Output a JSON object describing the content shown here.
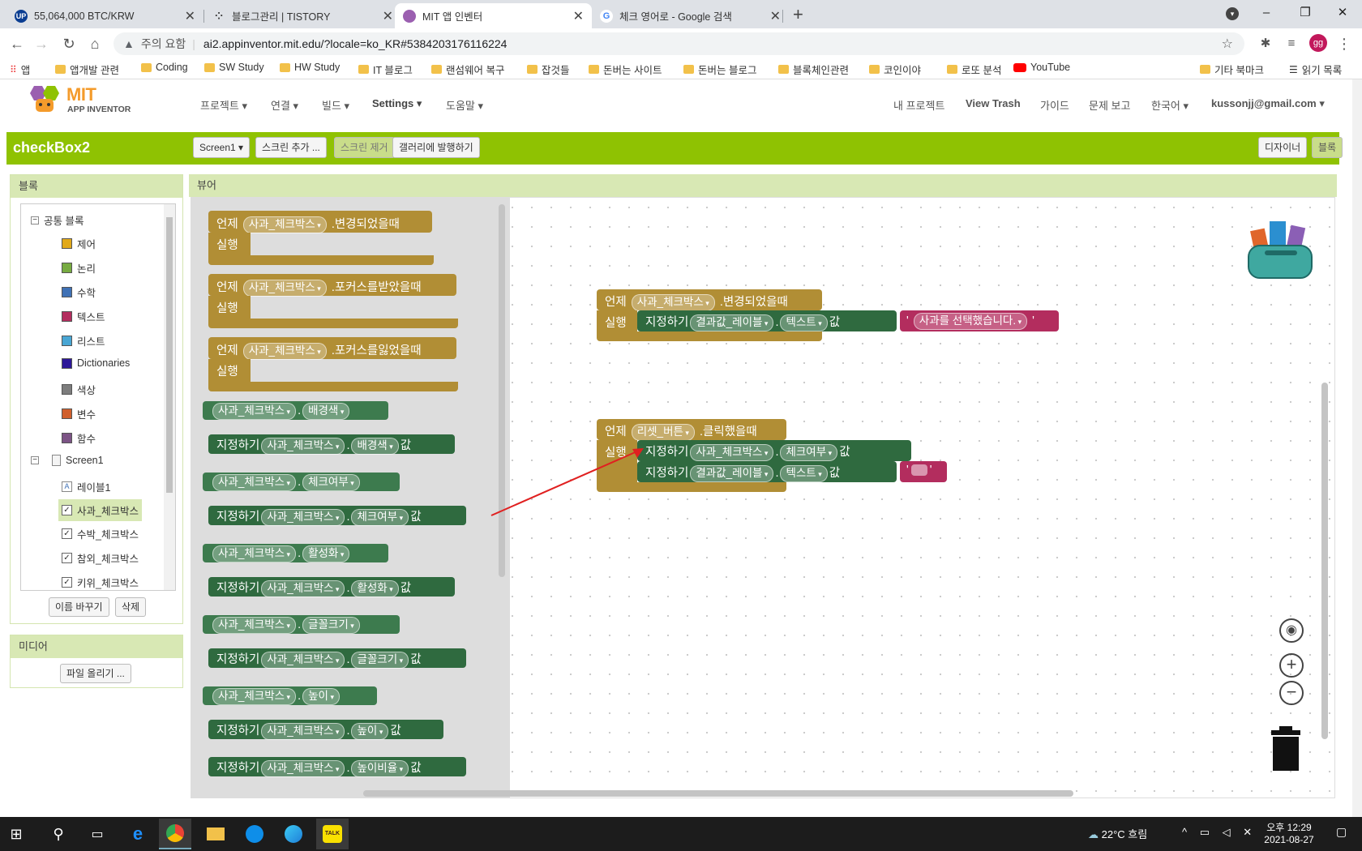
{
  "browser": {
    "tabs": [
      {
        "title": "55,064,000 BTC/KRW",
        "icon": "upbit-icon",
        "active": false
      },
      {
        "title": "블로그관리 | TISTORY",
        "icon": "tistory-icon",
        "active": false
      },
      {
        "title": "MIT 앱 인벤터",
        "icon": "mit-icon",
        "active": true
      },
      {
        "title": "체크 영어로 - Google 검색",
        "icon": "google-icon",
        "active": false
      }
    ],
    "security_label": "주의 요함",
    "url": "ai2.appinventor.mit.edu/?locale=ko_KR#5384203176116224",
    "profile_initials": "gg",
    "bookmarks": [
      "앱",
      "앱개발 관련",
      "Coding",
      "SW Study",
      "HW Study",
      "IT 블로그",
      "랜섬웨어 복구",
      "잡것들",
      "돈버는 사이트",
      "돈버는 블로그",
      "블록체인관련",
      "코인이야",
      "로또 분석",
      "YouTube",
      "기타 북마크",
      "읽기 목록"
    ]
  },
  "app": {
    "logo_mit": "MIT",
    "logo_sub": "APP INVENTOR",
    "menu": [
      "프로젝트",
      "연결",
      "빌드",
      "Settings",
      "도움말"
    ],
    "right_menu": [
      "내 프로젝트",
      "View Trash",
      "가이드",
      "문제 보고",
      "한국어",
      "kussonjj@gmail.com"
    ],
    "project_name": "checkBox2",
    "screen_select": "Screen1",
    "add_screen": "스크린 추가 ...",
    "remove_screen": "스크린 제거",
    "publish_gallery": "갤러리에 발행하기",
    "designer_btn": "디자이너",
    "blocks_btn": "블록"
  },
  "blocks_panel": {
    "title": "블록",
    "builtin_label": "공통 블록",
    "builtin": [
      {
        "label": "제어",
        "color": "#e1a91a"
      },
      {
        "label": "논리",
        "color": "#77ab41"
      },
      {
        "label": "수학",
        "color": "#3f71b5"
      },
      {
        "label": "텍스트",
        "color": "#b32d5e"
      },
      {
        "label": "리스트",
        "color": "#49a6d4"
      },
      {
        "label": "Dictionaries",
        "color": "#2d1799"
      },
      {
        "label": "색상",
        "color": "#7d7d7d"
      },
      {
        "label": "변수",
        "color": "#d05f2d"
      },
      {
        "label": "함수",
        "color": "#7c5385"
      }
    ],
    "screen_label": "Screen1",
    "components": [
      "레이블1",
      "사과_체크박스",
      "수박_체크박스",
      "참외_체크박스",
      "키위_체크박스"
    ],
    "rename_btn": "이름 바꾸기",
    "delete_btn": "삭제"
  },
  "media_panel": {
    "title": "미디어",
    "upload_btn": "파일 올리기 ..."
  },
  "viewer": {
    "title": "뷰어",
    "flyout": {
      "event1": {
        "when": "언제",
        "comp": "사과_체크박스",
        "event": ".변경되었을때",
        "do": "실행"
      },
      "event2": {
        "when": "언제",
        "comp": "사과_체크박스",
        "event": ".포커스를받았을때",
        "do": "실행"
      },
      "event3": {
        "when": "언제",
        "comp": "사과_체크박스",
        "event": ".포커스를잃었을때",
        "do": "실행"
      },
      "set": "지정하기",
      "value": "값",
      "comp": "사과_체크박스",
      "props": [
        "배경색",
        "체크여부",
        "활성화",
        "글꼴크기",
        "높이"
      ],
      "last_prop": "높이비율"
    },
    "canvas": {
      "b1": {
        "when": "언제",
        "comp": "사과_체크박스",
        "event": ".변경되었을때",
        "do": "실행",
        "set": "지정하기",
        "target": "결과값_레이블",
        "prop": "텍스트",
        "value": "값",
        "text": "사과를 선택했습니다."
      },
      "b2": {
        "when": "언제",
        "comp": "리셋_버튼",
        "event": ".클릭했을때",
        "do": "실행",
        "set": "지정하기",
        "comp2": "사과_체크박스",
        "prop1": "체크여부",
        "value": "값",
        "target": "결과값_레이블",
        "prop2": "텍스트"
      }
    }
  },
  "taskbar": {
    "weather": "22°C  흐림",
    "time": "오후 12:29",
    "date": "2021-08-27"
  }
}
